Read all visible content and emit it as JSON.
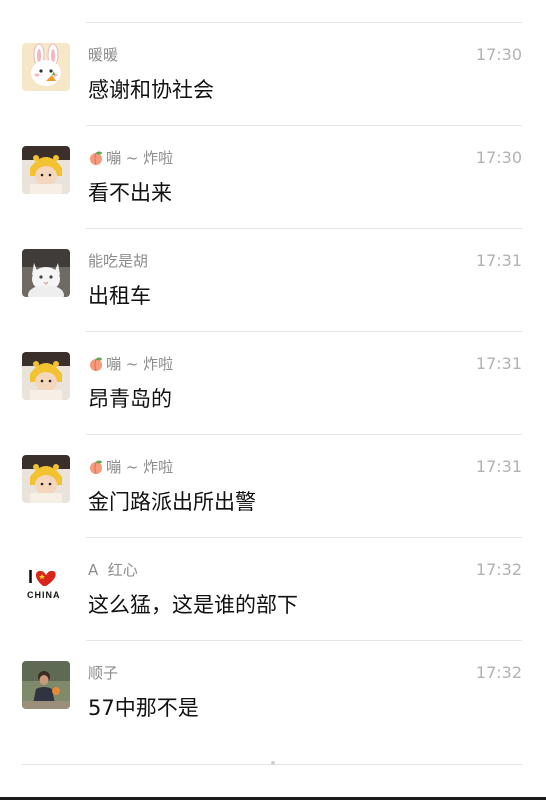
{
  "messages": [
    {
      "avatar": "bunny-avatar",
      "name_icon": "",
      "name": "暖暖",
      "time": "17:30",
      "text": "感谢和协社会"
    },
    {
      "avatar": "baby-yellow-hat-avatar",
      "name_icon": "peach-icon",
      "name": "嘣 ~ 炸啦",
      "time": "17:30",
      "text": "看不出来"
    },
    {
      "avatar": "cat-avatar",
      "name_icon": "",
      "name": "能吃是胡",
      "time": "17:31",
      "text": "出租车"
    },
    {
      "avatar": "baby-yellow-hat-avatar",
      "name_icon": "peach-icon",
      "name": "嘣 ~ 炸啦",
      "time": "17:31",
      "text": "昂青岛的"
    },
    {
      "avatar": "baby-yellow-hat-avatar",
      "name_icon": "peach-icon",
      "name": "嘣 ~ 炸啦",
      "time": "17:31",
      "text": "金门路派出所出警"
    },
    {
      "avatar": "i-love-china-avatar",
      "name_icon": "",
      "name": "A  红心",
      "time": "17:32",
      "text": "这么猛，这是谁的部下"
    },
    {
      "avatar": "person-photo-avatar",
      "name_icon": "",
      "name": "顺子",
      "time": "17:32",
      "text": "57中那不是"
    }
  ],
  "avatar_text": {
    "i_love_line": "I",
    "china": "CHINA"
  },
  "colors": {
    "name": "#8c8c8c",
    "time": "#b2b2b2",
    "text": "#111111",
    "divider": "#e6e6e6"
  }
}
